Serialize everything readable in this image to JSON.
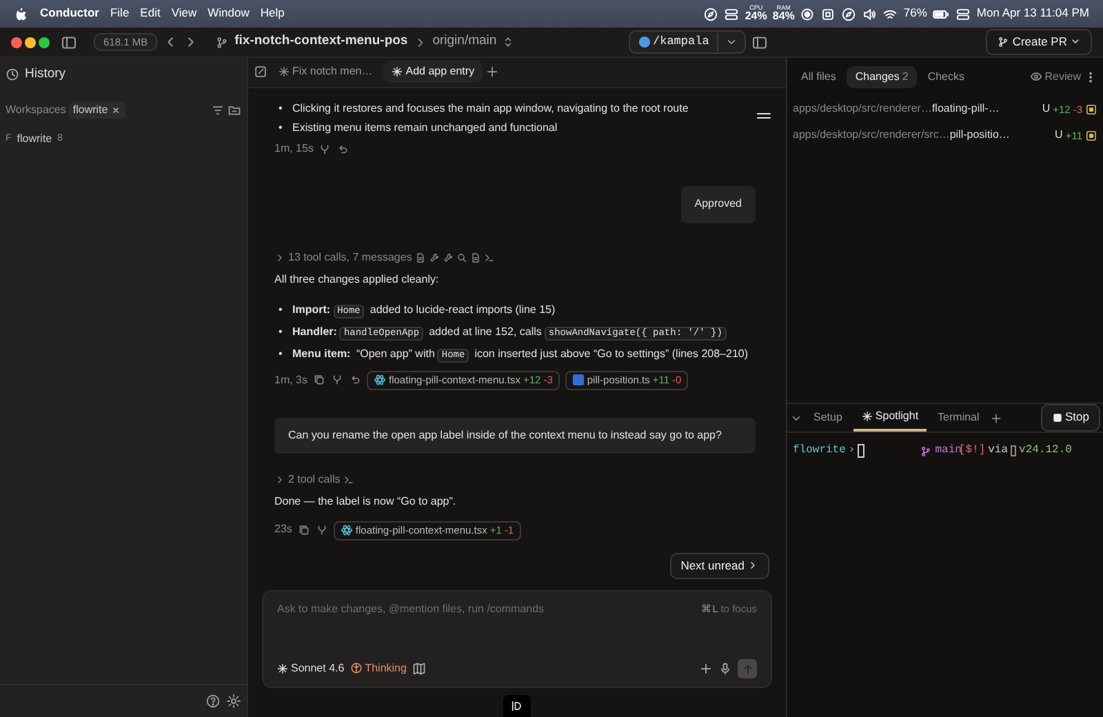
{
  "menubar": {
    "app": "Conductor",
    "menus": [
      "File",
      "Edit",
      "View",
      "Window",
      "Help"
    ],
    "cpu_label": "CPU",
    "cpu": "24%",
    "ram_label": "RAM",
    "ram": "84%",
    "battery": "76%",
    "clock": "Mon Apr 13  11:04 PM"
  },
  "toolbar": {
    "memory": "618.1 MB",
    "branch": "fix-notch-context-menu-pos",
    "base": "origin/main",
    "workspace_path": "/kampala",
    "create_pr": "Create PR"
  },
  "sidebar": {
    "history": "History",
    "workspaces_label": "Workspaces",
    "filter_tag": "flowrite",
    "repos": [
      {
        "initial": "F",
        "name": "flowrite",
        "count": "8"
      }
    ]
  },
  "chat_tabs": [
    {
      "label": "Fix notch men…",
      "selected": false
    },
    {
      "label": "Add app entry",
      "selected": true
    }
  ],
  "messages": [
    {
      "kind": "bullets",
      "marker": "•",
      "items": [
        {
          "parts": [
            {
              "kind": "text",
              "text": "Clicking it restores and focuses the main app window, navigating to the root route"
            }
          ]
        },
        {
          "parts": [
            {
              "kind": "text",
              "text": "Existing menu items remain unchanged and functional"
            }
          ]
        }
      ]
    },
    {
      "kind": "meta",
      "time": "1m, 15s",
      "actions": [
        {
          "kind": "fork"
        },
        {
          "kind": "undo"
        }
      ]
    },
    {
      "kind": "reply_chip",
      "text": "Approved"
    },
    {
      "kind": "tools",
      "text": "13 tool calls, 7 messages",
      "icons": [
        {
          "kind": "file"
        },
        {
          "kind": "wrench"
        },
        {
          "kind": "wrench"
        },
        {
          "kind": "search"
        },
        {
          "kind": "file"
        },
        {
          "kind": "terminal"
        }
      ]
    },
    {
      "kind": "text",
      "text": "All three changes applied cleanly:"
    },
    {
      "kind": "bullets",
      "marker": "•",
      "items": [
        {
          "parts": [
            {
              "kind": "label",
              "text": "Import:"
            },
            {
              "kind": "code",
              "text": "Home"
            },
            {
              "kind": "text",
              "text": "added to lucide-react imports (line 15)"
            }
          ]
        },
        {
          "parts": [
            {
              "kind": "label",
              "text": "Handler:"
            },
            {
              "kind": "code",
              "text": "handleOpenApp"
            },
            {
              "kind": "text",
              "text": "added at line 152, calls"
            },
            {
              "kind": "code",
              "text": "showAndNavigate({ path: '/' })"
            }
          ]
        },
        {
          "parts": [
            {
              "kind": "label",
              "text": "Menu item:"
            },
            {
              "kind": "text",
              "text": "“Open app” with"
            },
            {
              "kind": "code",
              "text": "Home"
            },
            {
              "kind": "text",
              "text": "icon inserted just above “Go to settings” (lines 208–210)"
            }
          ]
        }
      ]
    },
    {
      "kind": "meta",
      "time": "1m, 3s",
      "actions": [
        {
          "kind": "copy"
        },
        {
          "kind": "fork"
        },
        {
          "kind": "undo"
        }
      ],
      "files": [
        {
          "kind": "react",
          "name": "floating-pill-context-menu.tsx",
          "add": "+12",
          "del": "-3"
        },
        {
          "kind": "ts",
          "name": "pill-position.ts",
          "add": "+11",
          "del": "-0"
        }
      ]
    },
    {
      "kind": "user",
      "text": "Can you rename the open app label inside of the context menu to instead say go to app?"
    },
    {
      "kind": "tools",
      "text": "2 tool calls",
      "icons": [
        {
          "kind": "terminal"
        }
      ]
    },
    {
      "kind": "text",
      "text": "Done — the label is now “Go to app”."
    },
    {
      "kind": "meta",
      "time": "23s",
      "actions": [
        {
          "kind": "copy"
        },
        {
          "kind": "fork"
        }
      ],
      "files": [
        {
          "kind": "react",
          "name": "floating-pill-context-menu.tsx",
          "add": "+1",
          "del": "-1"
        }
      ]
    }
  ],
  "next_unread": "Next unread",
  "composer": {
    "placeholder": "Ask to make changes, @mention files, run /commands",
    "shortcut_key": "⌘L",
    "shortcut_hint": "to focus",
    "model": "Sonnet 4.6",
    "thinking": "Thinking"
  },
  "changes_tabs": [
    {
      "label": "All files",
      "selected": false
    },
    {
      "label": "Changes",
      "count": "2",
      "selected": true
    },
    {
      "label": "Checks",
      "selected": false
    }
  ],
  "review": "Review",
  "changed_files": [
    {
      "dir": "apps/desktop/src/renderer…",
      "name": "floating-pill-…",
      "status": "U",
      "add": "+12",
      "del": "-3"
    },
    {
      "dir": "apps/desktop/src/renderer/src…",
      "name": "pill-positio…",
      "status": "U",
      "add": "+11"
    }
  ],
  "terminal_tabs": [
    {
      "label": "Setup",
      "selected": false
    },
    {
      "label": "Spotlight",
      "selected": true
    },
    {
      "label": "Terminal",
      "selected": false
    }
  ],
  "stop": "Stop",
  "prompt": {
    "dir": "flowrite",
    "arrow": "›",
    "branch": "main",
    "flags": "[$!]",
    "via": "via",
    "version": "v24.12.0"
  }
}
